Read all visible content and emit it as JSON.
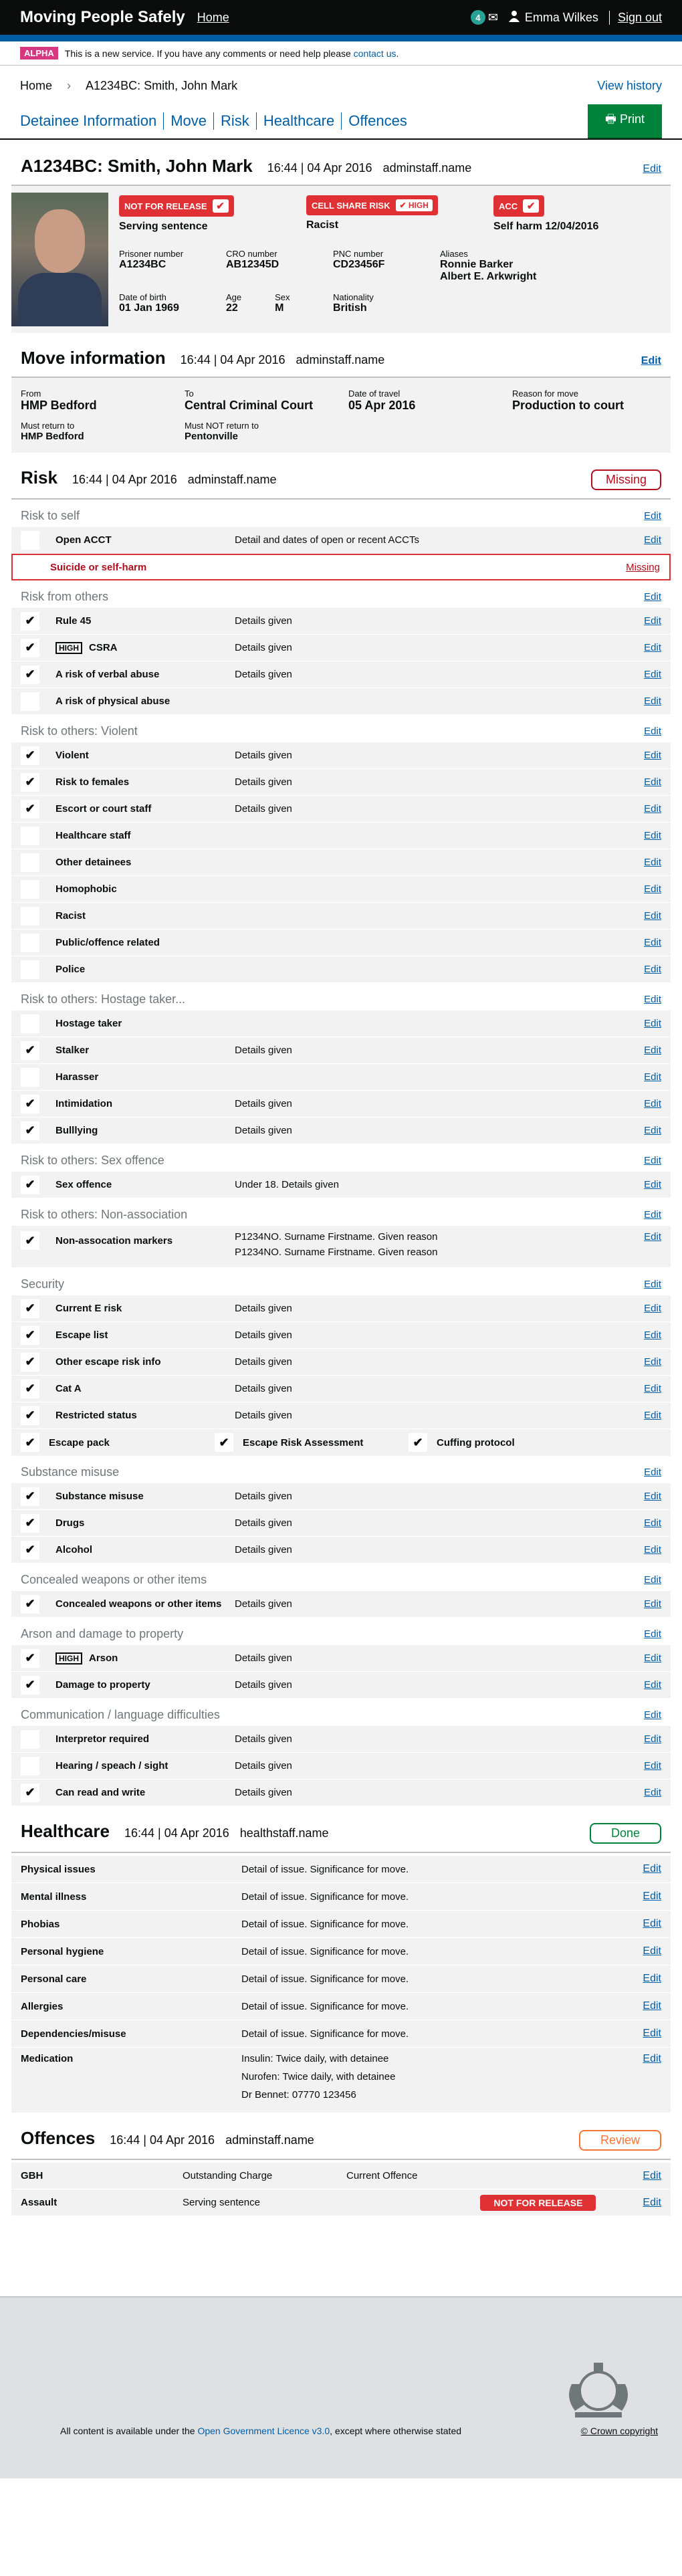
{
  "header": {
    "brand": "Moving People Safely",
    "home": "Home",
    "notif_count": "4",
    "user": "Emma Wilkes",
    "signout": "Sign out"
  },
  "alpha": {
    "tag": "ALPHA",
    "text": "This is a new service. If you have any comments or need help please ",
    "link": "contact us",
    "end": "."
  },
  "breadcrumb": {
    "home": "Home",
    "current": "A1234BC: Smith, John Mark",
    "view_history": "View history"
  },
  "tabs": [
    "Detainee Information",
    "Move",
    "Risk",
    "Healthcare",
    "Offences"
  ],
  "print": "Print",
  "detainee": {
    "title": "A1234BC: Smith, John Mark",
    "time": "16:44 | 04 Apr 2016",
    "user": "adminstaff.name",
    "edit": "Edit",
    "alerts": [
      {
        "label": "NOT FOR RELEASE",
        "sub": "Serving sentence"
      },
      {
        "label": "CELL SHARE RISK",
        "tag": "HIGH",
        "sub": "Racist"
      },
      {
        "label": "ACC",
        "sub": "Self harm 12/04/2016"
      }
    ],
    "facts": [
      {
        "label": "Prisoner number",
        "value": "A1234BC"
      },
      {
        "label": "CRO number",
        "value": "AB12345D"
      },
      {
        "label": "PNC number",
        "value": "CD23456F"
      },
      {
        "label": "Aliases",
        "value": "Ronnie Barker",
        "value2": "Albert E. Arkwright"
      },
      {
        "label": "Date of birth",
        "value": "01 Jan 1969"
      },
      {
        "label": "Age",
        "value": "22"
      },
      {
        "label": "Sex",
        "value": "M"
      },
      {
        "label": "Nationality",
        "value": "British"
      }
    ]
  },
  "move": {
    "title": "Move information",
    "time": "16:44 | 04 Apr 2016",
    "user": "adminstaff.name",
    "edit": "Edit",
    "fields": [
      {
        "label": "From",
        "value": "HMP Bedford"
      },
      {
        "label": "To",
        "value": "Central Criminal Court"
      },
      {
        "label": "Date of travel",
        "value": "05 Apr 2016"
      },
      {
        "label": "Reason for move",
        "value": "Production to court"
      },
      {
        "label": "Must return to",
        "value": "HMP Bedford"
      },
      {
        "label": "Must NOT return to",
        "value": "Pentonville"
      }
    ]
  },
  "risk": {
    "title": "Risk",
    "time": "16:44 | 04 Apr 2016",
    "user": "adminstaff.name",
    "status": "Missing",
    "edit": "Edit",
    "missing": "Missing",
    "high": "HIGH",
    "self": {
      "title": "Risk to self",
      "rows": [
        {
          "label": "Open ACCT",
          "detail": "Detail and dates of open or recent ACCTs"
        }
      ],
      "missing_label": "Suicide or self-harm"
    },
    "others": {
      "title": "Risk from others",
      "rows": [
        {
          "label": "Rule 45",
          "detail": "Details given",
          "c": true
        },
        {
          "label": "CSRA",
          "detail": "Details given",
          "c": true,
          "high": true
        },
        {
          "label": "A risk of verbal abuse",
          "detail": "Details given",
          "c": true
        },
        {
          "label": "A risk of physical abuse",
          "detail": "",
          "c": false
        }
      ]
    },
    "violent": {
      "title": "Risk to others: Violent",
      "rows": [
        {
          "label": "Violent",
          "detail": "Details given",
          "c": true
        },
        {
          "label": "Risk to females",
          "detail": "Details given",
          "c": true
        },
        {
          "label": "Escort or court staff",
          "detail": "Details given",
          "c": true
        },
        {
          "label": "Healthcare staff",
          "detail": "",
          "c": false
        },
        {
          "label": "Other detainees",
          "detail": "",
          "c": false
        },
        {
          "label": "Homophobic",
          "detail": "",
          "c": false
        },
        {
          "label": "Racist",
          "detail": "",
          "c": false
        },
        {
          "label": "Public/offence related",
          "detail": "",
          "c": false
        },
        {
          "label": "Police",
          "detail": "",
          "c": false
        }
      ]
    },
    "hostage": {
      "title": "Risk to others: Hostage taker...",
      "rows": [
        {
          "label": "Hostage taker",
          "detail": "",
          "c": false
        },
        {
          "label": "Stalker",
          "detail": "Details given",
          "c": true
        },
        {
          "label": "Harasser",
          "detail": "",
          "c": false
        },
        {
          "label": "Intimidation",
          "detail": "Details given",
          "c": true
        },
        {
          "label": "Bulllying",
          "detail": "Details given",
          "c": true
        }
      ]
    },
    "sex": {
      "title": "Risk to others: Sex offence",
      "rows": [
        {
          "label": "Sex offence",
          "detail": "Under 18. Details given",
          "c": true
        }
      ]
    },
    "nonassoc": {
      "title": "Risk to others: Non-association",
      "label": "Non-assocation markers",
      "lines": [
        "P1234NO. Surname Firstname. Given reason",
        "P1234NO. Surname Firstname. Given reason"
      ]
    },
    "security": {
      "title": "Security",
      "rows": [
        {
          "label": "Current E risk",
          "detail": "Details given",
          "c": true
        },
        {
          "label": "Escape list",
          "detail": "Details given",
          "c": true
        },
        {
          "label": "Other escape risk info",
          "detail": "Details given",
          "c": true
        },
        {
          "label": "Cat A",
          "detail": "Details given",
          "c": true
        },
        {
          "label": "Restricted status",
          "detail": "Details given",
          "c": true
        }
      ],
      "extra": [
        "Escape pack",
        "Escape Risk Assessment",
        "Cuffing protocol"
      ]
    },
    "substance": {
      "title": "Substance misuse",
      "rows": [
        {
          "label": "Substance misuse",
          "detail": "Details given",
          "c": true
        },
        {
          "label": "Drugs",
          "detail": "Details given",
          "c": true
        },
        {
          "label": "Alcohol",
          "detail": "Details given",
          "c": true
        }
      ]
    },
    "concealed": {
      "title": "Concealed weapons or other items",
      "rows": [
        {
          "label": "Concealed weapons or other items",
          "detail": "Details given",
          "c": true
        }
      ]
    },
    "arson": {
      "title": "Arson and damage to property",
      "rows": [
        {
          "label": "Arson",
          "detail": "Details given",
          "c": true,
          "high": true
        },
        {
          "label": "Damage to property",
          "detail": "Details given",
          "c": true
        }
      ]
    },
    "comm": {
      "title": "Communication / language difficulties",
      "rows": [
        {
          "label": "Interpretor required",
          "detail": "Details given",
          "c": false
        },
        {
          "label": "Hearing / speach / sight",
          "detail": "Details given",
          "c": false
        },
        {
          "label": "Can read and write",
          "detail": "Details given",
          "c": true
        }
      ]
    }
  },
  "healthcare": {
    "title": "Healthcare",
    "time": "16:44 | 04 Apr 2016",
    "user": "healthstaff.name",
    "status": "Done",
    "edit": "Edit",
    "rows": [
      {
        "label": "Physical issues",
        "detail": "Detail of issue. Significance for move."
      },
      {
        "label": "Mental illness",
        "detail": "Detail of issue. Significance for move."
      },
      {
        "label": "Phobias",
        "detail": "Detail of issue. Significance for move."
      },
      {
        "label": "Personal hygiene",
        "detail": "Detail of issue. Significance for move."
      },
      {
        "label": "Personal care",
        "detail": "Detail of issue. Significance for move."
      },
      {
        "label": "Allergies",
        "detail": "Detail of issue. Significance for move."
      },
      {
        "label": "Dependencies/misuse",
        "detail": "Detail of issue. Significance for move."
      }
    ],
    "medication": {
      "label": "Medication",
      "lines": [
        "Insulin: Twice daily, with detainee",
        "Nurofen: Twice daily, with detainee",
        "Dr Bennet: 07770 123456"
      ]
    }
  },
  "offences": {
    "title": "Offences",
    "time": "16:44 | 04 Apr 2016",
    "user": "adminstaff.name",
    "status": "Review",
    "edit": "Edit",
    "rows": [
      {
        "label": "GBH",
        "c2": "Outstanding Charge",
        "c3": "Current Offence"
      },
      {
        "label": "Assault",
        "c2": "Serving sentence",
        "badge": "NOT FOR RELEASE"
      }
    ]
  },
  "footer": {
    "prefix": "All content is available under the ",
    "link": "Open Government Licence v3.0",
    "suffix": ", except where otherwise stated",
    "copyright": "© Crown copyright"
  }
}
